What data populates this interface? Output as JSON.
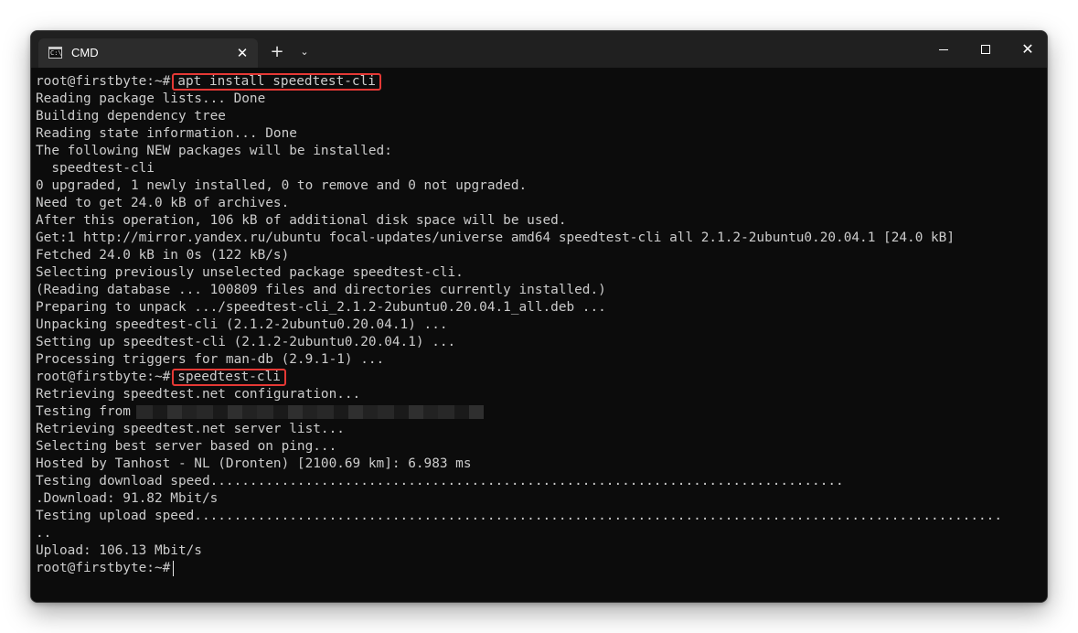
{
  "window": {
    "tab_title": "CMD",
    "tab_icon_text": "C:\\",
    "tab_close": "✕",
    "new_tab": "+",
    "dropdown": "⌄",
    "close_glyph": "✕",
    "colors": {
      "terminal_bg": "#0c0c0c",
      "text": "#cccccc",
      "titlebar": "#202020",
      "highlight_box": "#e53935"
    }
  },
  "terminal": {
    "prompt": "root@firstbyte:~#",
    "cmd1": "apt install speedtest-cli",
    "cmd2": "speedtest-cli",
    "lines_a": [
      "Reading package lists... Done",
      "Building dependency tree",
      "Reading state information... Done",
      "The following NEW packages will be installed:",
      "  speedtest-cli",
      "0 upgraded, 1 newly installed, 0 to remove and 0 not upgraded.",
      "Need to get 24.0 kB of archives.",
      "After this operation, 106 kB of additional disk space will be used.",
      "Get:1 http://mirror.yandex.ru/ubuntu focal-updates/universe amd64 speedtest-cli all 2.1.2-2ubuntu0.20.04.1 [24.0 kB]",
      "Fetched 24.0 kB in 0s (122 kB/s)",
      "Selecting previously unselected package speedtest-cli.",
      "(Reading database ... 100809 files and directories currently installed.)",
      "Preparing to unpack .../speedtest-cli_2.1.2-2ubuntu0.20.04.1_all.deb ...",
      "Unpacking speedtest-cli (2.1.2-2ubuntu0.20.04.1) ...",
      "Setting up speedtest-cli (2.1.2-2ubuntu0.20.04.1) ...",
      "Processing triggers for man-db (2.9.1-1) ..."
    ],
    "retrieving_config": "Retrieving speedtest.net configuration...",
    "testing_from": "Testing from",
    "lines_b": [
      "Retrieving speedtest.net server list...",
      "Selecting best server based on ping...",
      "Hosted by Tanhost - NL (Dronten) [2100.69 km]: 6.983 ms",
      "Testing download speed................................................................................",
      ".Download: 91.82 Mbit/s",
      "Testing upload speed......................................................................................................",
      "..",
      "Upload: 106.13 Mbit/s"
    ]
  }
}
